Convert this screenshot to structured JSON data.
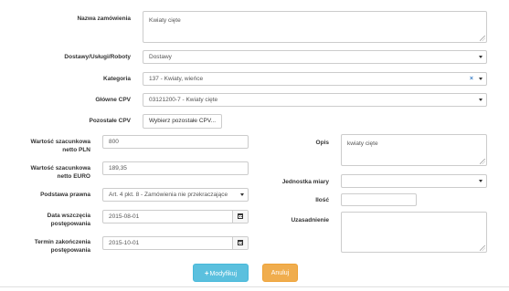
{
  "form": {
    "nazwa": {
      "label": "Nazwa zamówienia",
      "value": "Kwiaty cięte"
    },
    "dostawy": {
      "label": "Dostawy/Usługi/Roboty",
      "value": "Dostawy"
    },
    "kategoria": {
      "label": "Kategoria",
      "value": "137 - Kwiaty, wieńce",
      "clear": "×"
    },
    "glowne_cpv": {
      "label": "Główne CPV",
      "value": "03121200-7 - Kwiaty cięte"
    },
    "pozostale_cpv": {
      "label": "Pozostałe CPV",
      "button": "Wybierz pozostałe CPV..."
    },
    "wartosc_pln": {
      "label_line1": "Wartość szacunkowa",
      "label_line2": "netto PLN",
      "value": "800"
    },
    "wartosc_euro": {
      "label_line1": "Wartość szacunkowa",
      "label_line2": "netto EURO",
      "value": "189,35"
    },
    "podstawa": {
      "label": "Podstawa prawna",
      "value": "Art. 4 pkt. 8 - Zamówienia nie przekraczające"
    },
    "data_wszczecia": {
      "label_line1": "Data wszczęcia",
      "label_line2": "postępowania",
      "value": "2015-08-01"
    },
    "termin": {
      "label_line1": "Termin zakończenia",
      "label_line2": "postępowania",
      "value": "2015-10-01"
    },
    "opis": {
      "label": "Opis",
      "value": "kwiaty cięte"
    },
    "jednostka": {
      "label": "Jednostka miary",
      "value": ""
    },
    "ilosc": {
      "label": "Ilość",
      "value": ""
    },
    "uzasadnienie": {
      "label": "Uzasadnienie",
      "value": ""
    }
  },
  "buttons": {
    "modify_label": "Modyfikuj",
    "modify_icon": "plus-icon",
    "cancel_label": "Anuluj"
  },
  "colors": {
    "primary": "#5bc0de",
    "warning": "#f0ad4e",
    "border": "#cccccc",
    "clear_x": "#3a7fc6"
  }
}
